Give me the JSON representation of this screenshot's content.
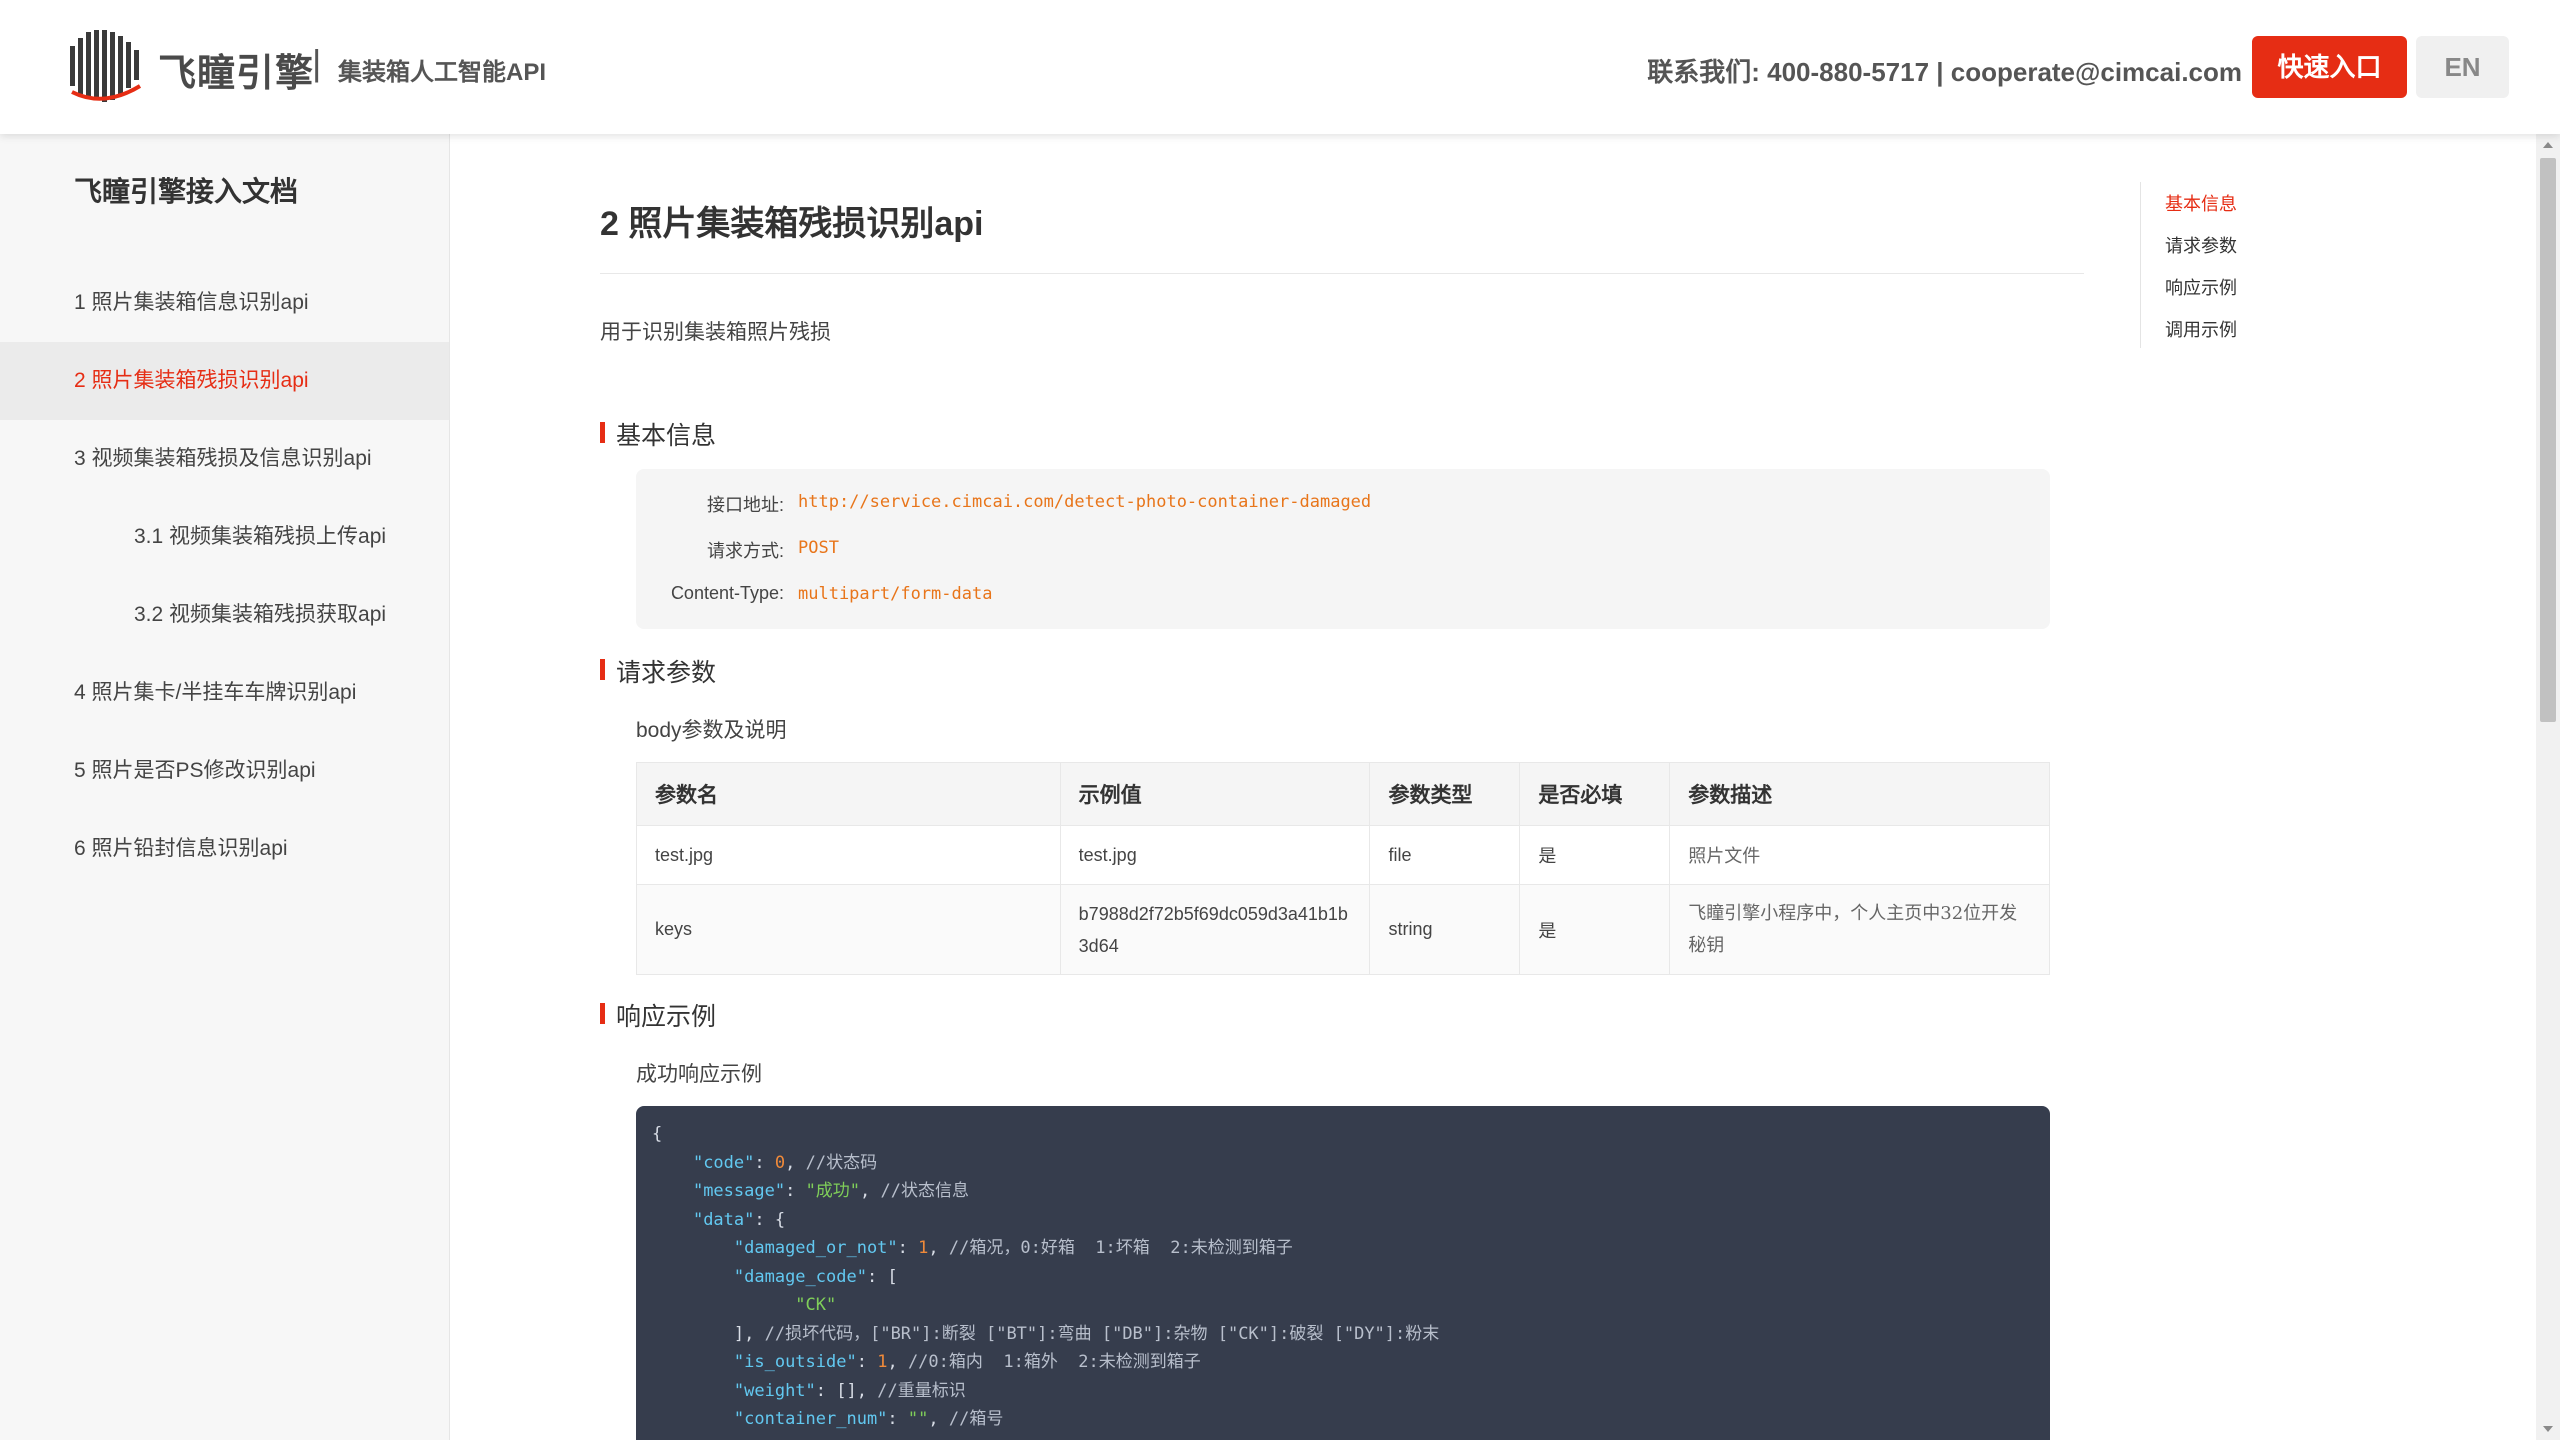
{
  "header": {
    "brand": "飞瞳引擎",
    "separator": "|",
    "subtitle": "集装箱人工智能API",
    "contact": "联系我们: 400-880-5717 | cooperate@cimcai.com",
    "quick_entry": "快速入口",
    "lang": "EN"
  },
  "sidebar": {
    "title": "飞瞳引擎接入文档",
    "items": [
      {
        "label": "1 照片集装箱信息识别api",
        "active": false
      },
      {
        "label": "2 照片集装箱残损识别api",
        "active": true
      },
      {
        "label": "3 视频集装箱残损及信息识别api",
        "active": false
      },
      {
        "label": "3.1 视频集装箱残损上传api",
        "active": false
      },
      {
        "label": "3.2 视频集装箱残损获取api",
        "active": false
      },
      {
        "label": "4 照片集卡/半挂车车牌识别api",
        "active": false
      },
      {
        "label": "5 照片是否PS修改识别api",
        "active": false
      },
      {
        "label": "6 照片铅封信息识别api",
        "active": false
      }
    ]
  },
  "main": {
    "title": "2 照片集装箱残损识别api",
    "description": "用于识别集装箱照片残损",
    "basic_info": {
      "heading": "基本信息",
      "rows": [
        {
          "label": "接口地址:",
          "value": "http://service.cimcai.com/detect-photo-container-damaged"
        },
        {
          "label": "请求方式:",
          "value": "POST"
        },
        {
          "label": "Content-Type:",
          "value": "multipart/form-data"
        }
      ]
    },
    "request_params": {
      "heading": "请求参数",
      "sub": "body参数及说明",
      "columns": [
        "参数名",
        "示例值",
        "参数类型",
        "是否必填",
        "参数描述"
      ],
      "rows": [
        [
          "test.jpg",
          "test.jpg",
          "file",
          "是",
          "照片文件"
        ],
        [
          "keys",
          "b7988d2f72b5f69dc059d3a41b1b3d64",
          "string",
          "是",
          "飞瞳引擎小程序中，个人主页中32位开发秘钥"
        ]
      ]
    },
    "response": {
      "heading": "响应示例",
      "sub": "成功响应示例",
      "code": {
        "l0": "{",
        "code_key": "\"code\"",
        "code_val": "0",
        "code_cmt": "//状态码",
        "msg_key": "\"message\"",
        "msg_val": "\"成功\"",
        "msg_cmt": "//状态信息",
        "data_key": "\"data\"",
        "dmg_key": "\"damaged_or_not\"",
        "dmg_val": "1",
        "dmg_cmt": "//箱况，0:好箱  1:坏箱  2:未检测到箱子",
        "dc_key": "\"damage_code\"",
        "dc_item": "\"CK\"",
        "dc_close": "],",
        "dc_cmt": "//损坏代码，[\"BR\"]:断裂 [\"BT\"]:弯曲 [\"DB\"]:杂物 [\"CK\"]:破裂 [\"DY\"]:粉末",
        "out_key": "\"is_outside\"",
        "out_val": "1",
        "out_cmt": "//0:箱内  1:箱外  2:未检测到箱子",
        "w_key": "\"weight\"",
        "w_val": "[]",
        "w_cmt": "//重量标识",
        "cn_key": "\"container_num\"",
        "cn_val": "\"\"",
        "cn_cmt": "//箱号"
      }
    }
  },
  "toc": {
    "items": [
      {
        "label": "基本信息",
        "active": true
      },
      {
        "label": "请求参数",
        "active": false
      },
      {
        "label": "响应示例",
        "active": false
      },
      {
        "label": "调用示例",
        "active": false
      }
    ]
  },
  "colors": {
    "accent": "#e62d14",
    "code_bg": "#363d4d",
    "code_value": "#e8751a"
  }
}
